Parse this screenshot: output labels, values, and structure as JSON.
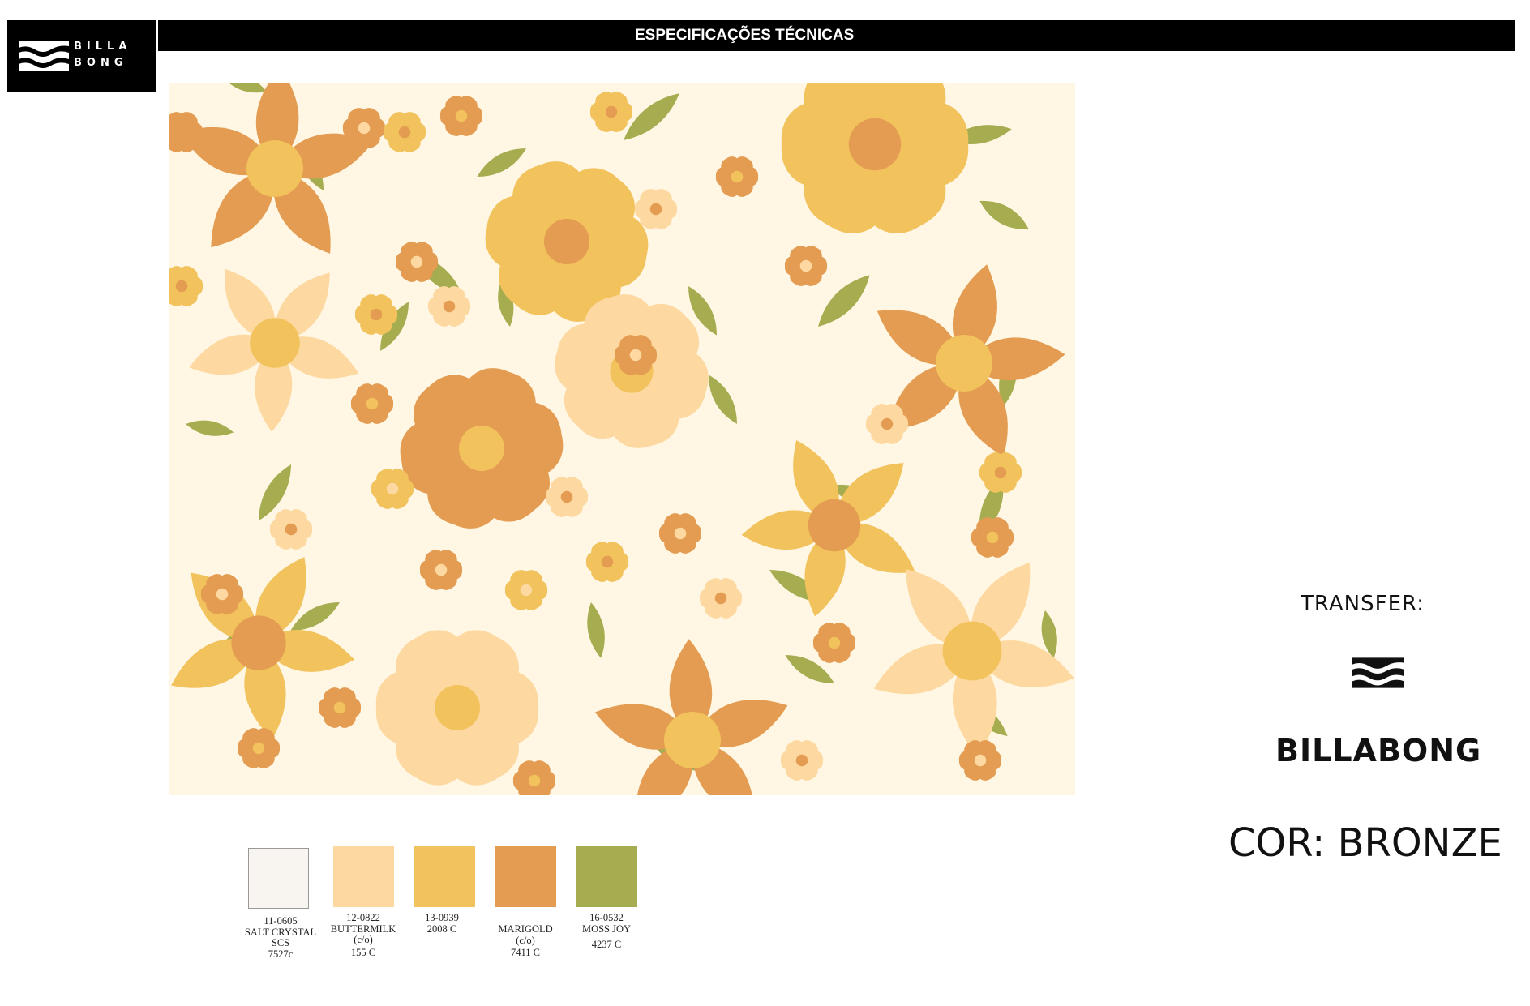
{
  "brand": {
    "logo_line1": "BILLA",
    "logo_line2": "BONG"
  },
  "header": {
    "title": "ESPECIFICAÇÕES TÉCNICAS"
  },
  "palette": [
    {
      "color": "#f8f5f1",
      "lines": [
        "11-0605",
        "SALT CRYSTAL",
        "SCS",
        "7527c"
      ]
    },
    {
      "color": "#fdd9a1",
      "lines": [
        "12-0822",
        "BUTTERMILK",
        "(c/o)",
        "155 C"
      ]
    },
    {
      "color": "#f2c25c",
      "lines": [
        "13-0939",
        "2008 C"
      ]
    },
    {
      "color": "#e39c51",
      "lines": [
        "MARIGOLD",
        "(c/o)",
        "7411 C"
      ]
    },
    {
      "color": "#a6ad50",
      "lines": [
        "16-0532",
        "MOSS JOY",
        "4237 C"
      ]
    }
  ],
  "transfer": {
    "label": "TRANSFER:",
    "brand_name": "BILLABONG"
  },
  "color_info": {
    "label": "COR: BRONZE"
  }
}
